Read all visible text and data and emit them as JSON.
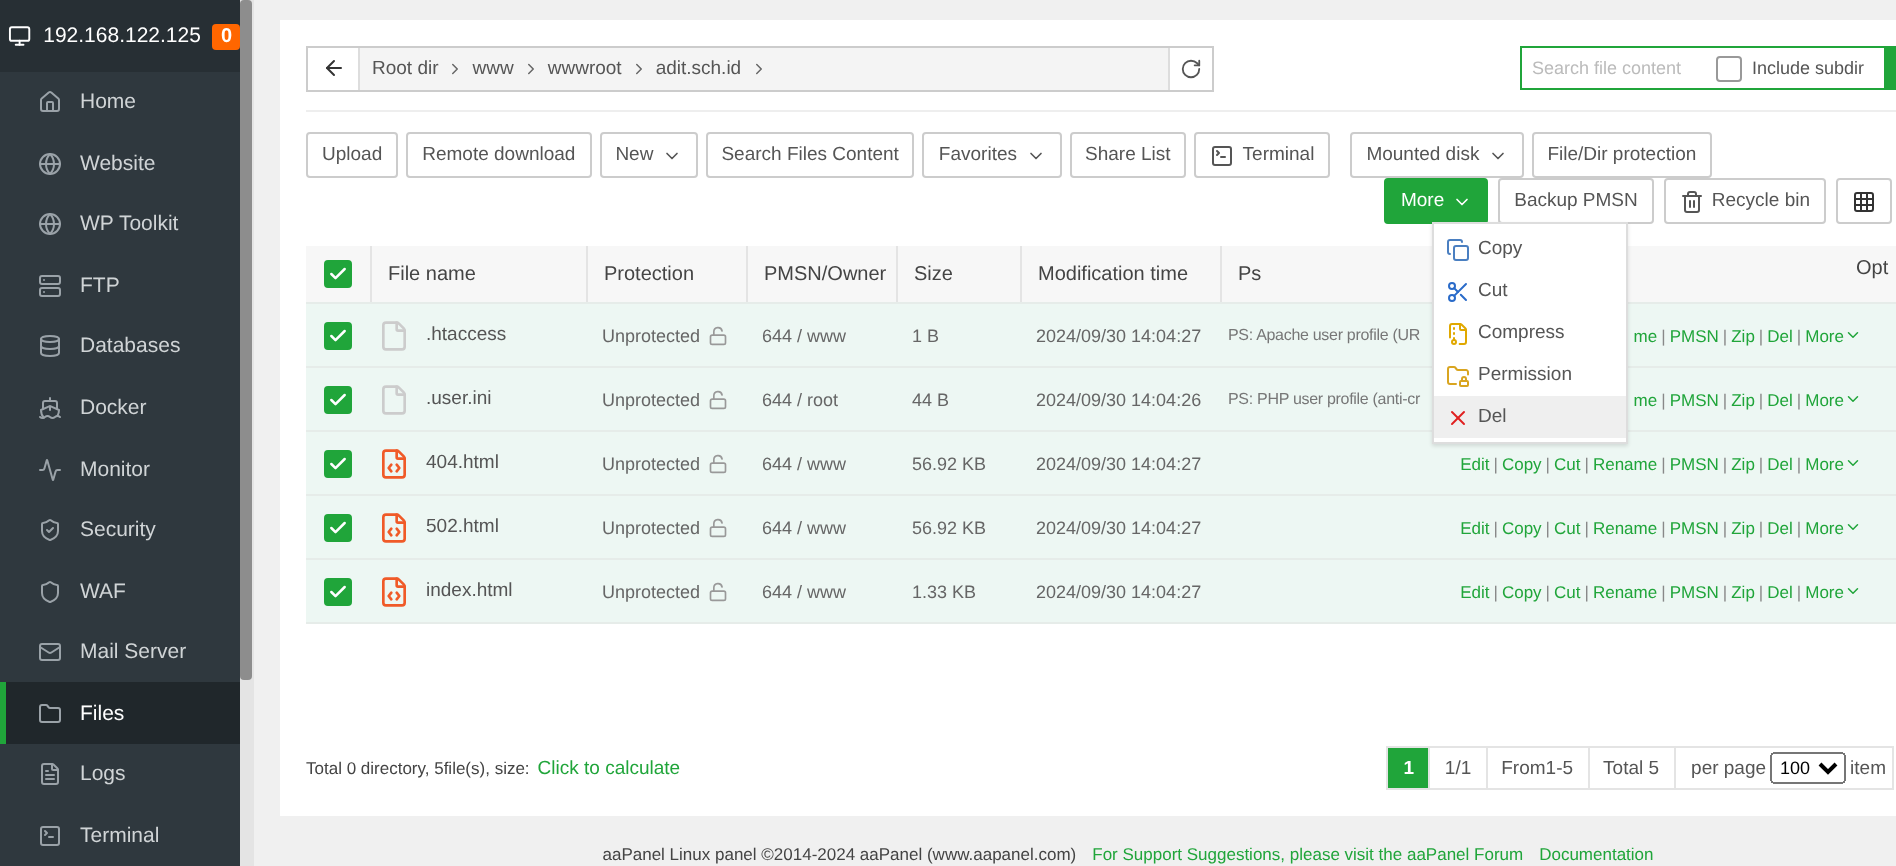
{
  "sidebar": {
    "host": "192.168.122.125",
    "badge": "0",
    "items": [
      {
        "label": "Home",
        "selected": false
      },
      {
        "label": "Website",
        "selected": false
      },
      {
        "label": "WP Toolkit",
        "selected": false
      },
      {
        "label": "FTP",
        "selected": false
      },
      {
        "label": "Databases",
        "selected": false
      },
      {
        "label": "Docker",
        "selected": false
      },
      {
        "label": "Monitor",
        "selected": false
      },
      {
        "label": "Security",
        "selected": false
      },
      {
        "label": "WAF",
        "selected": false
      },
      {
        "label": "Mail Server",
        "selected": false
      },
      {
        "label": "Files",
        "selected": true
      },
      {
        "label": "Logs",
        "selected": false
      },
      {
        "label": "Terminal",
        "selected": false
      }
    ]
  },
  "path_bar": {
    "crumbs": [
      "Root dir",
      "www",
      "wwwroot",
      "adit.sch.id"
    ]
  },
  "content_search": {
    "placeholder": "Search file content",
    "include_subdir": {
      "label": "Include subdir",
      "checked": false
    }
  },
  "toolbar": [
    {
      "label": "Upload",
      "kind": "plain"
    },
    {
      "label": "Remote download",
      "kind": "plain"
    },
    {
      "label": "New",
      "kind": "dropdown"
    },
    {
      "label": "Search Files Content",
      "kind": "plain"
    },
    {
      "label": "Favorites",
      "kind": "dropdown"
    },
    {
      "label": "Share List",
      "kind": "plain"
    },
    {
      "label": "Terminal",
      "kind": "terminal"
    },
    {
      "label": "Mounted disk",
      "kind": "select"
    },
    {
      "label": "File/Dir protection",
      "kind": "plain"
    }
  ],
  "toolbar_row2": [
    {
      "label": "More",
      "kind": "primary"
    },
    {
      "label": "Backup PMSN",
      "kind": "plain"
    },
    {
      "label": "Recycle bin",
      "kind": "trash"
    },
    {
      "kind": "grid"
    }
  ],
  "more_menu": [
    {
      "label": "Copy",
      "selected": false
    },
    {
      "label": "Cut",
      "selected": false
    },
    {
      "label": "Compress",
      "selected": false
    },
    {
      "label": "Permission",
      "selected": false
    },
    {
      "label": "Del",
      "selected": true
    }
  ],
  "table": {
    "select_all": true,
    "columns": [
      "File name",
      "Protection",
      "PMSN/Owner",
      "Size",
      "Modification time",
      "Ps",
      "Opt"
    ],
    "rows": [
      {
        "checked": true,
        "kind": "text",
        "name": ".htaccess",
        "protection": "Unprotected",
        "pmsn": "644 / www",
        "size": "1 B",
        "modified": "2024/09/30 14:04:27",
        "ps": "PS: Apache user profile (UR",
        "actions": [
          "me",
          "|",
          "PMSN",
          "|",
          "Zip",
          "|",
          "Del",
          "|",
          "More"
        ]
      },
      {
        "checked": true,
        "kind": "text",
        "name": ".user.ini",
        "protection": "Unprotected",
        "pmsn": "644 / root",
        "size": "44 B",
        "modified": "2024/09/30 14:04:26",
        "ps": "PS: PHP user profile (anti-cr",
        "actions": [
          "me",
          "|",
          "PMSN",
          "|",
          "Zip",
          "|",
          "Del",
          "|",
          "More"
        ]
      },
      {
        "checked": true,
        "kind": "html",
        "name": "404.html",
        "protection": "Unprotected",
        "pmsn": "644 / www",
        "size": "56.92 KB",
        "modified": "2024/09/30 14:04:27",
        "actions": [
          "Edit",
          "|",
          "Copy",
          "|",
          "Cut",
          "|",
          "Rename",
          "|",
          "PMSN",
          "|",
          "Zip",
          "|",
          "Del",
          "|",
          "More"
        ]
      },
      {
        "checked": true,
        "kind": "html",
        "name": "502.html",
        "protection": "Unprotected",
        "pmsn": "644 / www",
        "size": "56.92 KB",
        "modified": "2024/09/30 14:04:27",
        "actions": [
          "Edit",
          "|",
          "Copy",
          "|",
          "Cut",
          "|",
          "Rename",
          "|",
          "PMSN",
          "|",
          "Zip",
          "|",
          "Del",
          "|",
          "More"
        ]
      },
      {
        "checked": true,
        "kind": "html",
        "name": "index.html",
        "protection": "Unprotected",
        "pmsn": "644 / www",
        "size": "1.33 KB",
        "modified": "2024/09/30 14:04:27",
        "actions": [
          "Edit",
          "|",
          "Copy",
          "|",
          "Cut",
          "|",
          "Rename",
          "|",
          "PMSN",
          "|",
          "Zip",
          "|",
          "Del",
          "|",
          "More"
        ]
      }
    ]
  },
  "summary": {
    "text": "Total 0 directory, 5file(s), size:",
    "link": "Click to calculate"
  },
  "pagination": {
    "pages": [
      {
        "label": "1",
        "selected": true
      }
    ],
    "info": [
      "1/1",
      "From1-5",
      "Total 5"
    ],
    "per_page_label": "per page",
    "per_page": "100",
    "suffix": "item"
  },
  "footer": {
    "copyright": "aaPanel Linux panel ©2014-2024 aaPanel (www.aapanel.com)",
    "links": [
      "For Support Suggestions, please visit the aaPanel Forum",
      "Documentation"
    ]
  }
}
